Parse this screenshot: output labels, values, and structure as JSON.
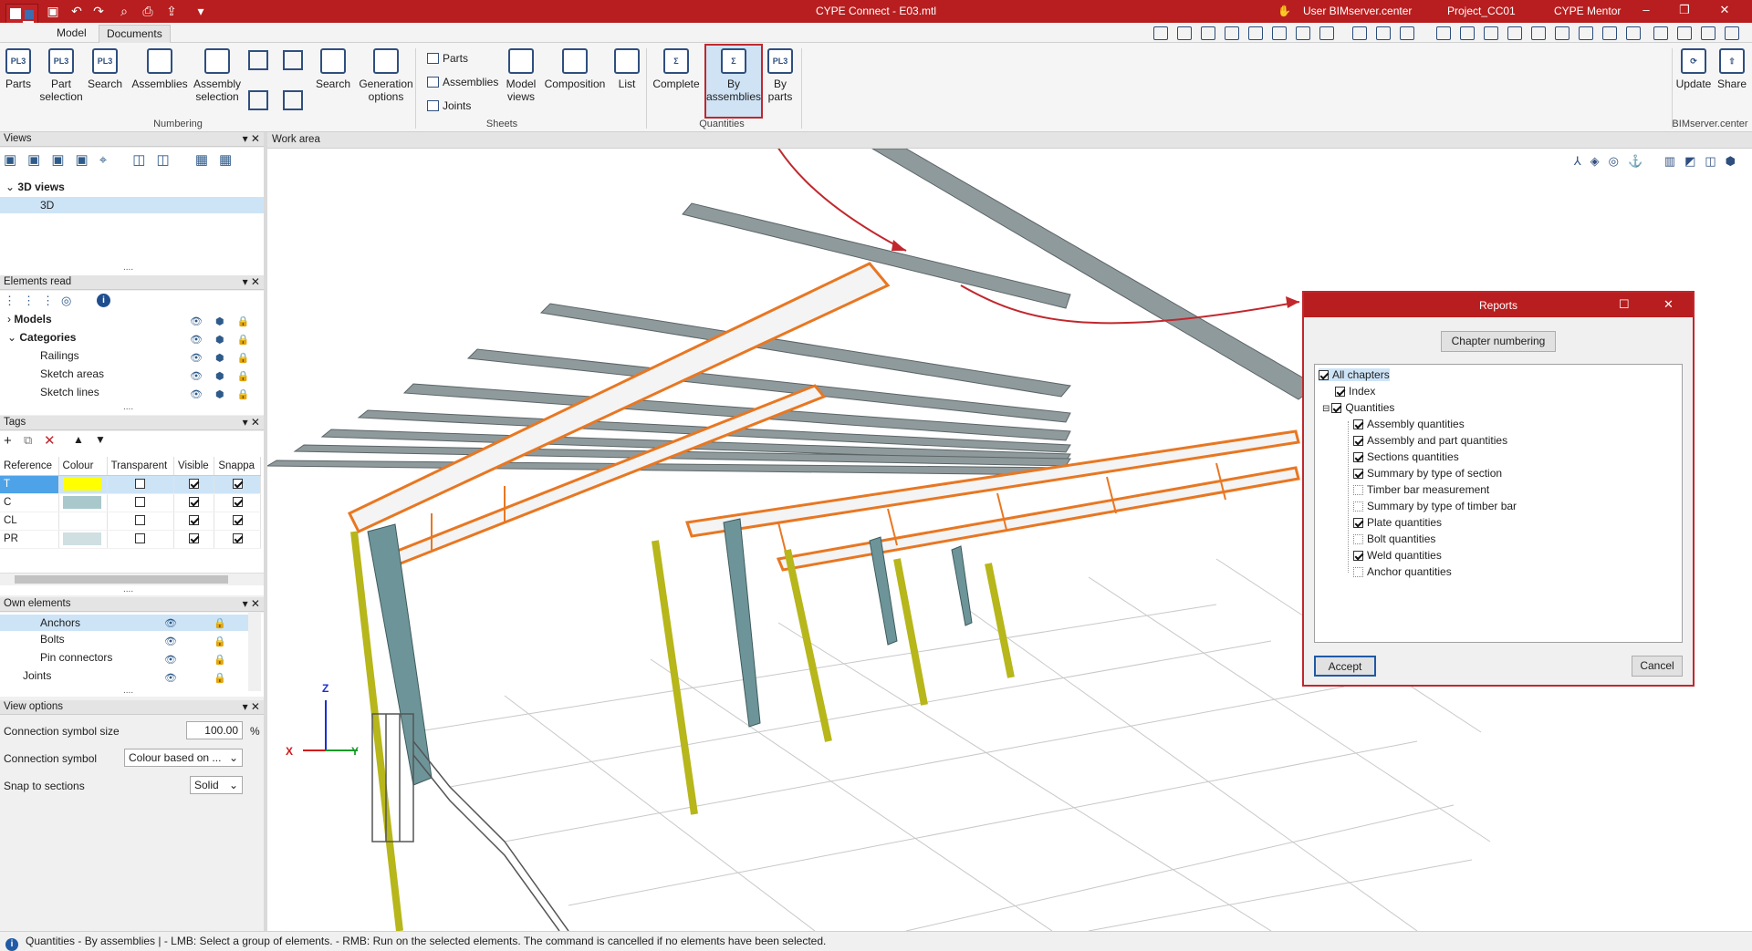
{
  "window": {
    "title": "CYPE Connect - E03.mtl"
  },
  "titlebar_right": {
    "user": "User BIMserver.center",
    "project": "Project_CC01",
    "mentor": "CYPE Mentor"
  },
  "tabs": [
    {
      "label": "Model"
    },
    {
      "label": "Documents"
    }
  ],
  "ribbon": {
    "numbering": {
      "group_label": "Numbering",
      "parts": "Parts",
      "part_selection_1": "Part",
      "part_selection_2": "selection",
      "search": "Search",
      "assemblies": "Assemblies",
      "assembly_selection_1": "Assembly",
      "assembly_selection_2": "selection",
      "search2": "Search"
    },
    "sheets": {
      "group_label": "Sheets",
      "generation_options_1": "Generation",
      "generation_options_2": "options",
      "parts": "Parts",
      "assemblies": "Assemblies",
      "joints": "Joints",
      "model_views_1": "Model",
      "model_views_2": "views",
      "composition": "Composition",
      "list": "List"
    },
    "quantities": {
      "group_label": "Quantities",
      "complete": "Complete",
      "by_assemblies_1": "By",
      "by_assemblies_2": "assemblies",
      "by_parts_1": "By",
      "by_parts_2": "parts"
    },
    "bimserver": {
      "group_label": "BIMserver.center",
      "update": "Update",
      "share": "Share"
    },
    "icon_text": {
      "pl3": "PL3"
    }
  },
  "views_panel": {
    "title": "Views",
    "group": "3D views",
    "item": "3D"
  },
  "elements_read": {
    "title": "Elements read",
    "rows": [
      "Models",
      "Categories",
      "Railings",
      "Sketch areas",
      "Sketch lines"
    ]
  },
  "tags": {
    "title": "Tags",
    "headers": [
      "Reference",
      "Colour",
      "Transparent",
      "Visible",
      "Snappa"
    ],
    "rows": [
      {
        "ref": "T",
        "color": "#ffff00",
        "transparent": false,
        "visible": true,
        "snap": true
      },
      {
        "ref": "C",
        "color": "#a8c8cc",
        "transparent": false,
        "visible": true,
        "snap": true
      },
      {
        "ref": "CL",
        "color": "#ffffff",
        "transparent": false,
        "visible": true,
        "snap": true
      },
      {
        "ref": "PR",
        "color": "#cfdfe2",
        "transparent": false,
        "visible": true,
        "snap": true
      }
    ]
  },
  "own_elements": {
    "title": "Own elements",
    "rows": [
      "Anchors",
      "Bolts",
      "Pin connectors",
      "Joints"
    ]
  },
  "view_options": {
    "title": "View options",
    "size_label": "Connection symbol size",
    "size_value": "100.00",
    "size_unit": "%",
    "symbol_label": "Connection symbol",
    "symbol_value": "Colour based on ...",
    "snap_label": "Snap to sections",
    "snap_value": "Solid"
  },
  "work_area": {
    "title": "Work area"
  },
  "axes": {
    "z": "Z",
    "x": "X",
    "y": "Y"
  },
  "dialog": {
    "title": "Reports",
    "chapter_numbering": "Chapter numbering",
    "items": [
      {
        "label": "All chapters",
        "checked": true
      },
      {
        "label": "Index",
        "checked": true
      },
      {
        "label": "Quantities",
        "checked": true
      },
      {
        "label": "Assembly quantities",
        "checked": true
      },
      {
        "label": "Assembly and part quantities",
        "checked": true
      },
      {
        "label": "Sections quantities",
        "checked": true
      },
      {
        "label": "Summary by type of section",
        "checked": true
      },
      {
        "label": "Timber bar measurement",
        "checked": false
      },
      {
        "label": "Summary by type of timber bar",
        "checked": false
      },
      {
        "label": "Plate quantities",
        "checked": true
      },
      {
        "label": "Bolt quantities",
        "checked": false
      },
      {
        "label": "Weld quantities",
        "checked": true
      },
      {
        "label": "Anchor quantities",
        "checked": false
      }
    ],
    "accept": "Accept",
    "cancel": "Cancel"
  },
  "status": {
    "text": "Quantities - By assemblies  |  - LMB: Select a group of elements. - RMB: Run on the selected elements. The command is cancelled if no elements have been selected."
  },
  "colors": {
    "brand_red": "#b81e1f",
    "highlight": "#c1272d",
    "selection": "#cde4f7"
  }
}
